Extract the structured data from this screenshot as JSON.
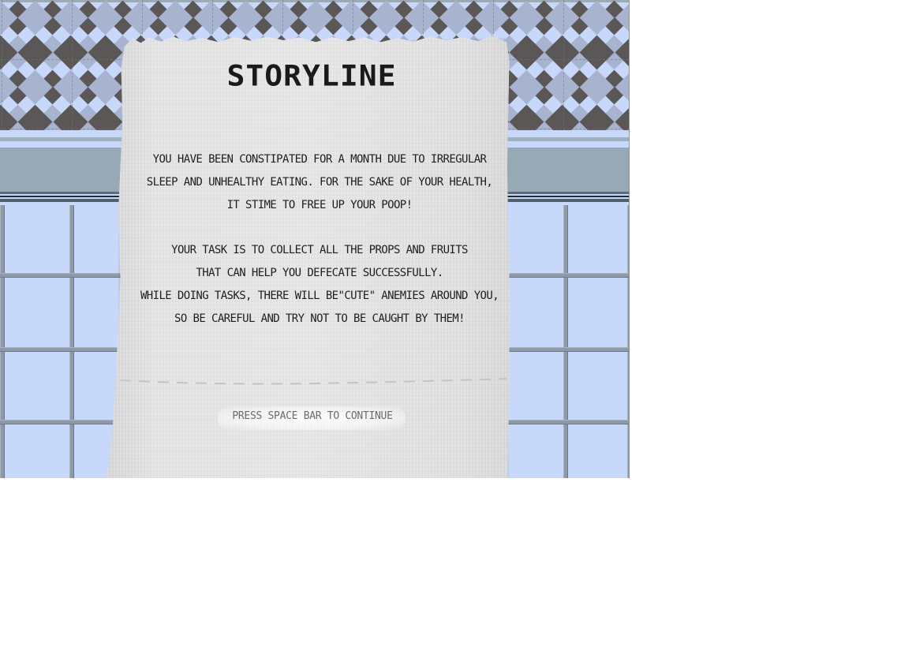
{
  "screen": {
    "title": "STORYLINE",
    "paragraph1": [
      "YOU HAVE BEEN CONSTIPATED FOR A MONTH DUE TO IRREGULAR",
      "SLEEP AND UNHEALTHY EATING. FOR THE SAKE OF YOUR HEALTH,",
      "IT STIME TO FREE UP YOUR POOP!"
    ],
    "paragraph2": [
      "YOUR TASK IS TO COLLECT ALL THE PROPS AND FRUITS",
      "THAT CAN HELP YOU DEFECATE SUCCESSFULLY.",
      "WHILE DOING TASKS, THERE WILL BE\"CUTE\" ANEMIES AROUND YOU,",
      "SO BE CAREFUL AND TRY NOT TO BE CAUGHT BY THEM!"
    ],
    "prompt": "PRESS SPACE BAR TO CONTINUE"
  },
  "colors": {
    "tile": "#c8d8fa",
    "diamond_dark": "#5a5756",
    "diamond_light": "#a8b3cf",
    "rail_band": "#97a9b5",
    "paper": "#e4e3e4",
    "text": "#1e1e1e",
    "prompt_text": "#6c6c6c"
  }
}
